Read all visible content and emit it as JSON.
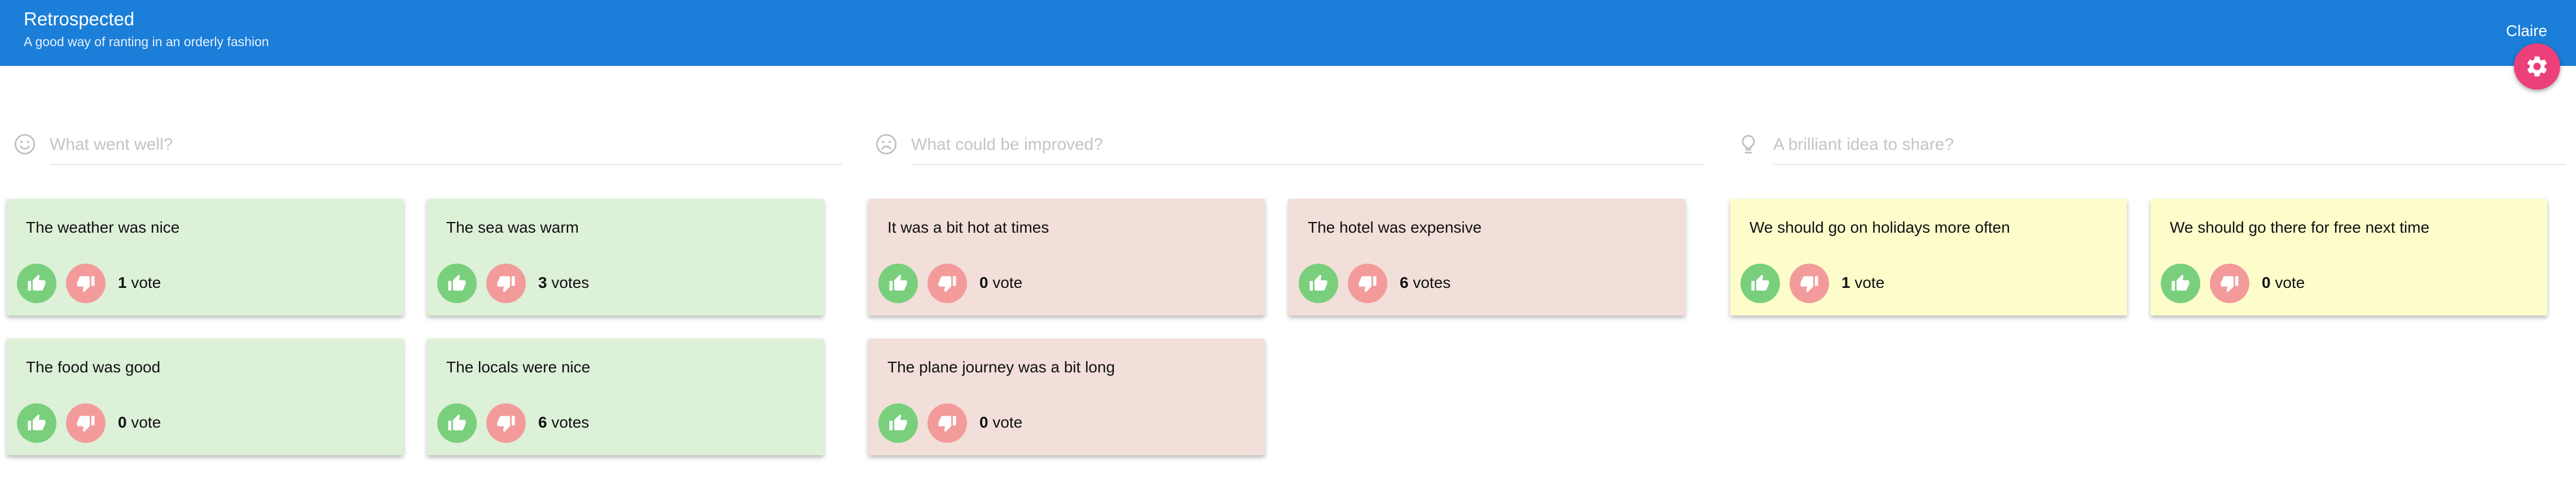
{
  "app": {
    "title": "Retrospected",
    "subtitle": "A good way of ranting in an orderly fashion",
    "user": "Claire",
    "accent_color": "#1b7ed8",
    "fab_color": "#ec407a",
    "fab_icon": "gear-icon"
  },
  "columns": [
    {
      "id": "well",
      "icon": "smile-icon",
      "placeholder": "What went well?",
      "card_color": "#ddf0d8",
      "posts": [
        {
          "text": "The weather was nice",
          "votes": "1",
          "label": "vote"
        },
        {
          "text": "The sea was warm",
          "votes": "3",
          "label": "votes"
        },
        {
          "text": "The food was good",
          "votes": "0",
          "label": "vote"
        },
        {
          "text": "The locals were nice",
          "votes": "6",
          "label": "votes"
        }
      ]
    },
    {
      "id": "improve",
      "icon": "frown-icon",
      "placeholder": "What could be improved?",
      "card_color": "#f2dfd9",
      "posts": [
        {
          "text": "It was a bit hot at times",
          "votes": "0",
          "label": "vote"
        },
        {
          "text": "The hotel was expensive",
          "votes": "6",
          "label": "votes"
        },
        {
          "text": "The plane journey was a bit long",
          "votes": "0",
          "label": "vote"
        }
      ]
    },
    {
      "id": "ideas",
      "icon": "lightbulb-icon",
      "placeholder": "A brilliant idea to share?",
      "card_color": "#fdfdcc",
      "posts": [
        {
          "text": "We should go on holidays more often",
          "votes": "1",
          "label": "vote"
        },
        {
          "text": "We should go there for free next time",
          "votes": "0",
          "label": "vote"
        }
      ]
    }
  ]
}
